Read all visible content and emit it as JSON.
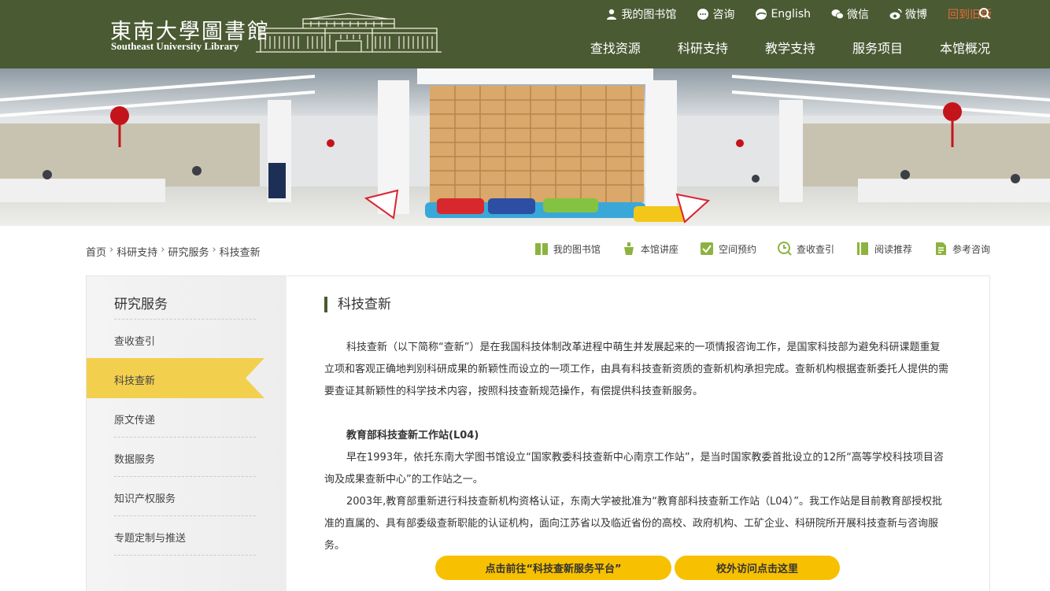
{
  "header": {
    "logo_cn": "東南大學圖書館",
    "logo_en": "Southeast University Library",
    "top_links": [
      {
        "label": "我的图书馆",
        "icon": "user-icon"
      },
      {
        "label": "咨询",
        "icon": "chat-icon"
      },
      {
        "label": "English",
        "icon": "globe-icon"
      },
      {
        "label": "微信",
        "icon": "wechat-icon"
      },
      {
        "label": "微博",
        "icon": "weibo-icon"
      },
      {
        "label": "回到旧版",
        "icon": ""
      }
    ],
    "nav": [
      "查找资源",
      "科研支持",
      "教学支持",
      "服务项目",
      "本馆概况"
    ],
    "colors": {
      "bar": "#4a5a33",
      "old_version": "#e86a38"
    }
  },
  "breadcrumb": [
    "首页",
    "科研支持",
    "研究服务",
    "科技查新"
  ],
  "quick_links": [
    {
      "label": "我的图书馆",
      "icon": "book-icon"
    },
    {
      "label": "本馆讲座",
      "icon": "lecture-icon"
    },
    {
      "label": "空间预约",
      "icon": "checkbox-icon"
    },
    {
      "label": "查收查引",
      "icon": "clock-search-icon"
    },
    {
      "label": "阅读推荐",
      "icon": "reading-icon"
    },
    {
      "label": "参考咨询",
      "icon": "document-icon"
    }
  ],
  "sidebar": {
    "title": "研究服务",
    "items": [
      "查收查引",
      "科技查新",
      "原文传递",
      "数据服务",
      "知识产权服务",
      "专题定制与推送"
    ],
    "active_index": 1
  },
  "content": {
    "title": "科技查新",
    "intro": "科技查新（以下简称“查新”）是在我国科技体制改革进程中萌生并发展起来的一项情报咨询工作，是国家科技部为避免科研课题重复立项和客观正确地判别科研成果的新颖性而设立的一项工作，由具有科技查新资质的查新机构承担完成。查新机构根据查新委托人提供的需要查证其新颖性的科学技术内容，按照科技查新规范操作，有偿提供科技查新服务。",
    "section_title": "教育部科技查新工作站(L04)",
    "para1": "早在1993年，依托东南大学图书馆设立“国家教委科技查新中心南京工作站”，是当时国家教委首批设立的12所“高等学校科技项目咨询及成果查新中心”的工作站之一。",
    "para2": "2003年,教育部重新进行科技查新机构资格认证，东南大学被批准为“教育部科技查新工作站（L04）”。我工作站是目前教育部授权批准的直属的、具有部委级查新职能的认证机构，面向江苏省以及临近省份的高校、政府机构、工矿企业、科研院所开展科技查新与咨询服务。",
    "buttons": [
      "点击前往“科技查新服务平台”",
      "校外访问点击这里"
    ]
  }
}
